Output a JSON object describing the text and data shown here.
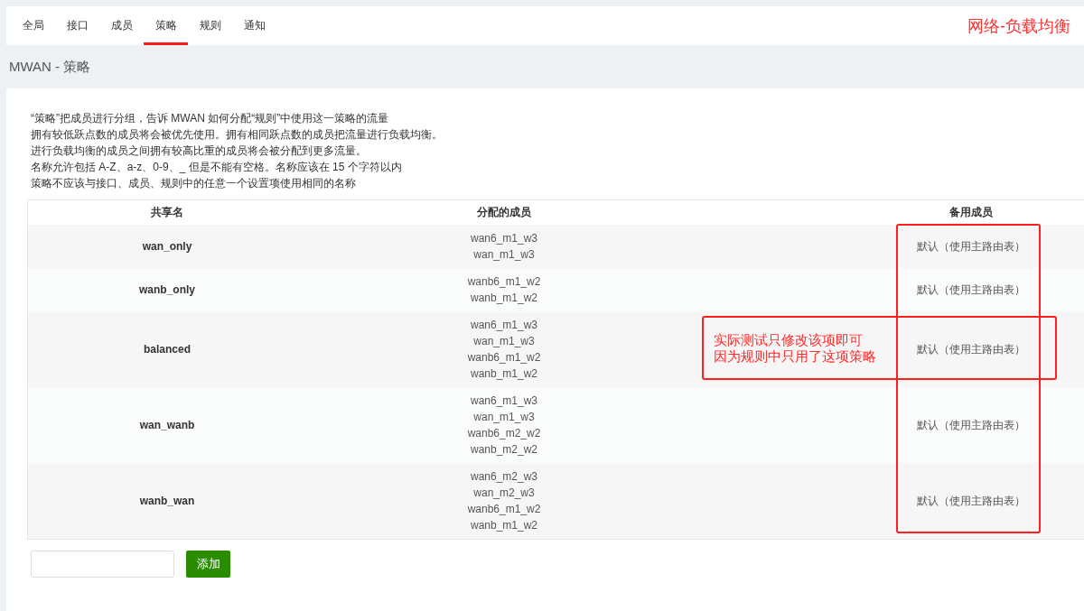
{
  "tabs": [
    {
      "label": "全局",
      "selected": false
    },
    {
      "label": "接口",
      "selected": false
    },
    {
      "label": "成员",
      "selected": false
    },
    {
      "label": "策略",
      "selected": true
    },
    {
      "label": "规则",
      "selected": false
    },
    {
      "label": "通知",
      "selected": false
    }
  ],
  "header_note": "网络-负载均衡",
  "page_title": "MWAN - 策略",
  "description": [
    "“策略”把成员进行分组，告诉 MWAN 如何分配“规则”中使用这一策略的流量",
    "拥有较低跃点数的成员将会被优先使用。拥有相同跃点数的成员把流量进行负载均衡。",
    "进行负载均衡的成员之间拥有较高比重的成员将会被分配到更多流量。",
    "名称允许包括 A-Z、a-z、0-9、_ 但是不能有空格。名称应该在 15 个字符以内",
    "策略不应该与接口、成员、规则中的任意一个设置项使用相同的名称"
  ],
  "table": {
    "columns": [
      "共享名",
      "分配的成员",
      "备用成员"
    ],
    "rows": [
      {
        "name": "wan_only",
        "members": [
          "wan6_m1_w3",
          "wan_m1_w3"
        ],
        "fallback": "默认（使用主路由表）"
      },
      {
        "name": "wanb_only",
        "members": [
          "wanb6_m1_w2",
          "wanb_m1_w2"
        ],
        "fallback": "默认（使用主路由表）"
      },
      {
        "name": "balanced",
        "members": [
          "wan6_m1_w3",
          "wan_m1_w3",
          "wanb6_m1_w2",
          "wanb_m1_w2"
        ],
        "fallback": "默认（使用主路由表）"
      },
      {
        "name": "wan_wanb",
        "members": [
          "wan6_m1_w3",
          "wan_m1_w3",
          "wanb6_m2_w2",
          "wanb_m2_w2"
        ],
        "fallback": "默认（使用主路由表）"
      },
      {
        "name": "wanb_wan",
        "members": [
          "wan6_m2_w3",
          "wan_m2_w3",
          "wanb6_m1_w2",
          "wanb_m1_w2"
        ],
        "fallback": "默认（使用主路由表）"
      }
    ]
  },
  "add_form": {
    "button": "添加"
  },
  "annotations": [
    {
      "kind": "frame"
    },
    {
      "kind": "callout",
      "lines": [
        "实际测试只修改该项即可",
        "因为规则中只用了这项策略"
      ]
    }
  ]
}
